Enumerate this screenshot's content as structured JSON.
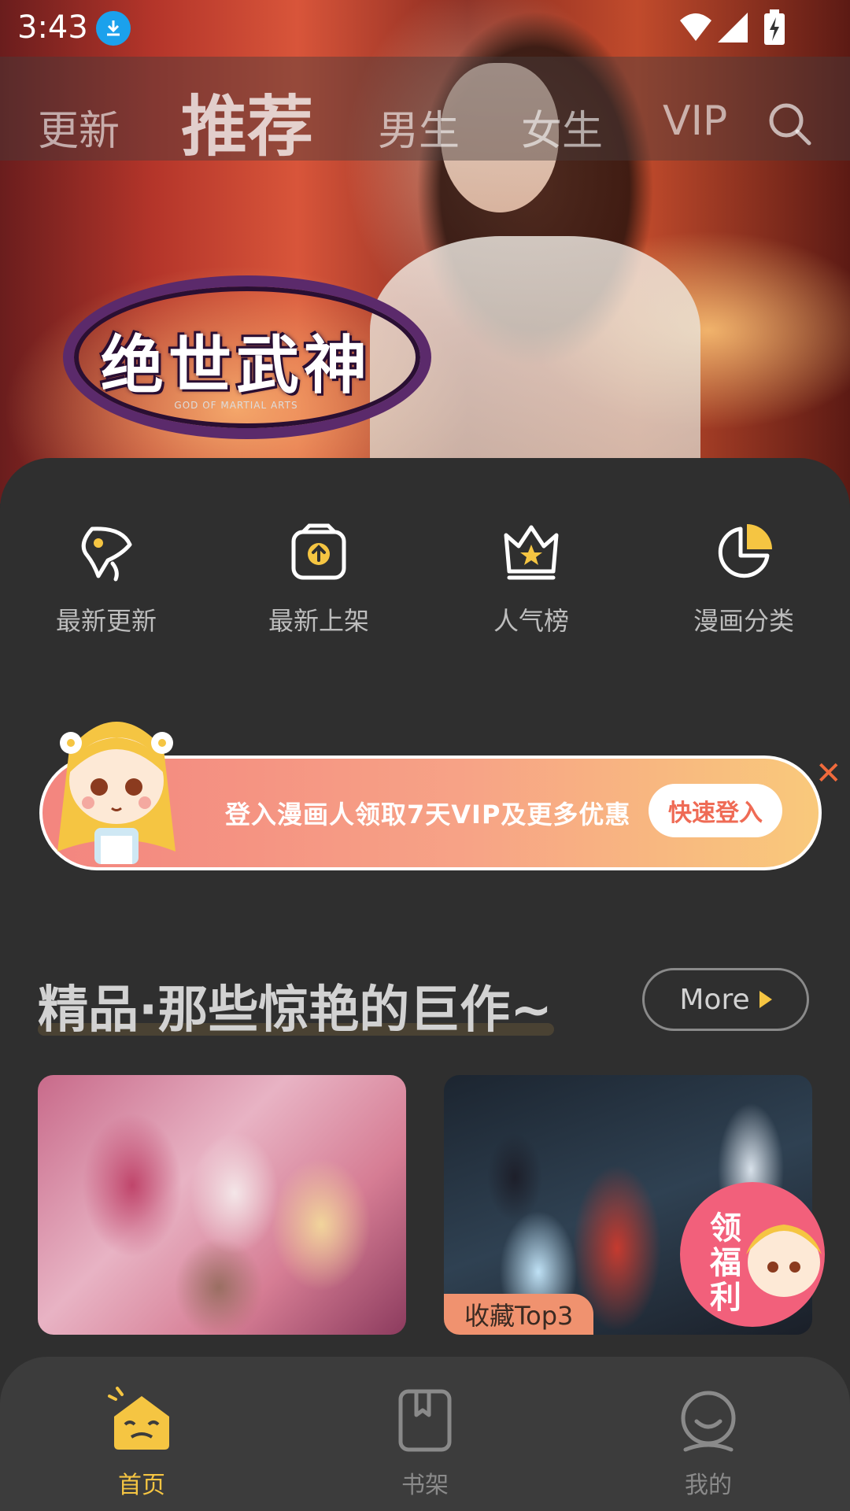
{
  "status_bar": {
    "time": "3:43"
  },
  "top_tabs": [
    {
      "label": "更新",
      "active": false
    },
    {
      "label": "推荐",
      "active": true
    },
    {
      "label": "男生",
      "active": false
    },
    {
      "label": "女生",
      "active": false
    },
    {
      "label": "VIP",
      "active": false
    }
  ],
  "banner": {
    "logo_text": "绝世武神",
    "logo_sub": "GOD OF MARTIAL ARTS"
  },
  "quick_links": [
    {
      "label": "最新更新",
      "icon": "rocket-icon"
    },
    {
      "label": "最新上架",
      "icon": "upload-box-icon"
    },
    {
      "label": "人气榜",
      "icon": "crown-icon"
    },
    {
      "label": "漫画分类",
      "icon": "pie-chart-icon"
    }
  ],
  "promo": {
    "text": "登入漫画人领取7天VIP及更多优惠",
    "button": "快速登入",
    "close": "✕"
  },
  "section": {
    "title": "精品·那些惊艳的巨作~",
    "more_label": "More"
  },
  "cards": [
    {
      "badge": ""
    },
    {
      "badge": "收藏Top3"
    }
  ],
  "gift_label": "领福利",
  "bottom_nav": [
    {
      "label": "首页",
      "active": true
    },
    {
      "label": "书架",
      "active": false
    },
    {
      "label": "我的",
      "active": false
    }
  ],
  "colors": {
    "accent": "#f5c542",
    "promo_button_text": "#ef6b55",
    "close": "#f06a3c",
    "background": "#2d2d2d"
  }
}
